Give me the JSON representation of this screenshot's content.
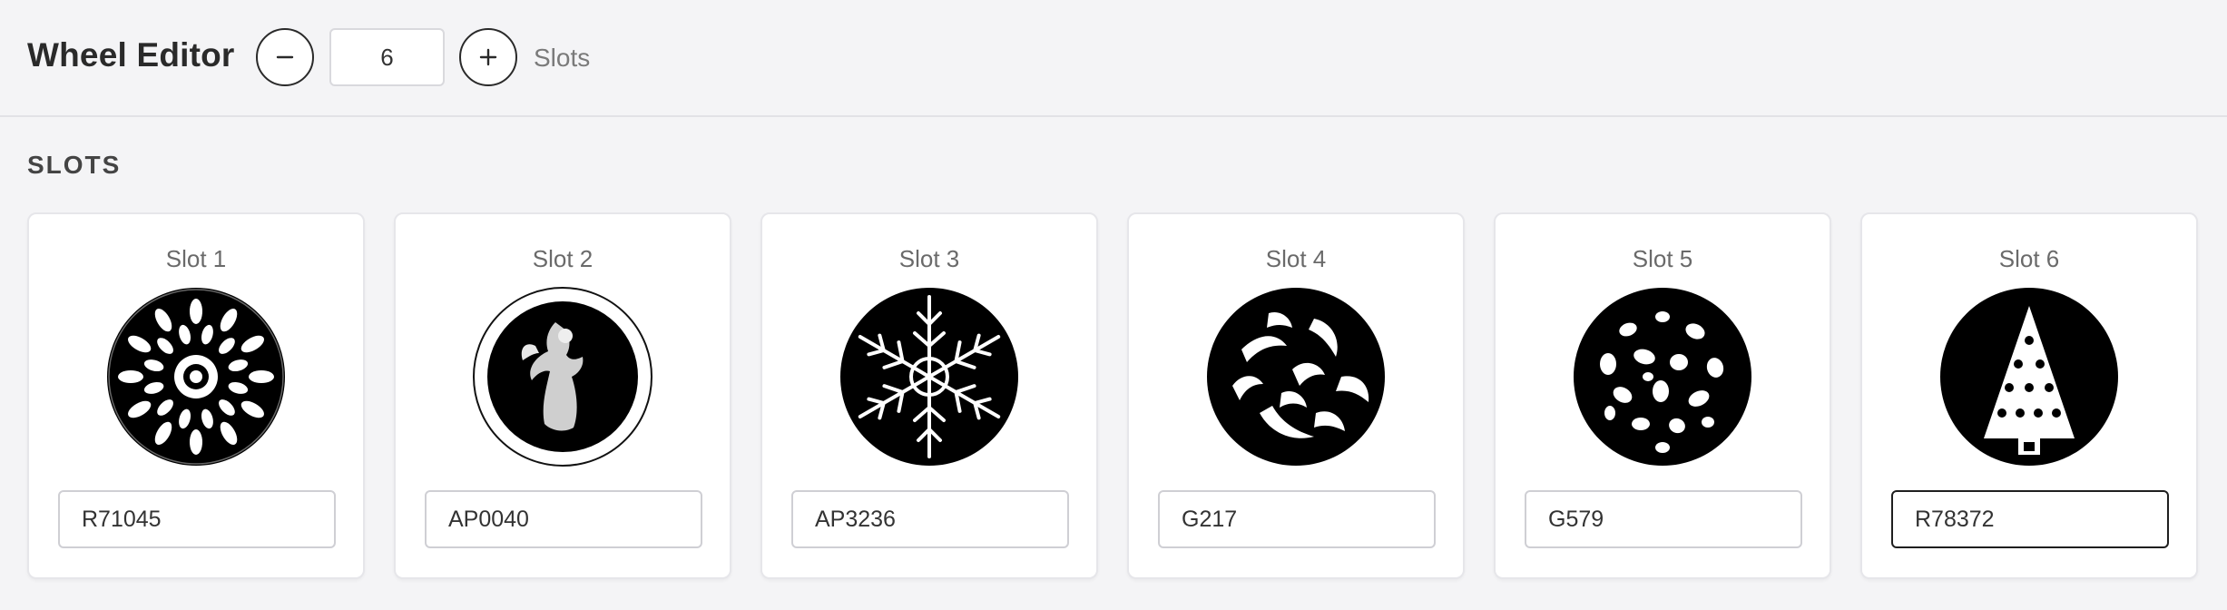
{
  "header": {
    "title": "Wheel Editor",
    "slot_count": "6",
    "slots_suffix": "Slots",
    "decrement_icon": "minus-icon",
    "increment_icon": "plus-icon"
  },
  "section": {
    "title": "SLOTS"
  },
  "slots": [
    {
      "label": "Slot 1",
      "value": "R71045",
      "gobo": "mandala-gobo-icon"
    },
    {
      "label": "Slot 2",
      "value": "AP0040",
      "gobo": "angel-gobo-icon"
    },
    {
      "label": "Slot 3",
      "value": "AP3236",
      "gobo": "snowflake-gobo-icon"
    },
    {
      "label": "Slot 4",
      "value": "G217",
      "gobo": "foliage-gobo-icon"
    },
    {
      "label": "Slot 5",
      "value": "G579",
      "gobo": "breakup-gobo-icon"
    },
    {
      "label": "Slot 6",
      "value": "R78372",
      "gobo": "christmas-tree-gobo-icon"
    }
  ],
  "colors": {
    "background": "#f4f4f6",
    "card": "#ffffff",
    "text": "#2a2a2a",
    "active_border": "#1f1f1f"
  }
}
